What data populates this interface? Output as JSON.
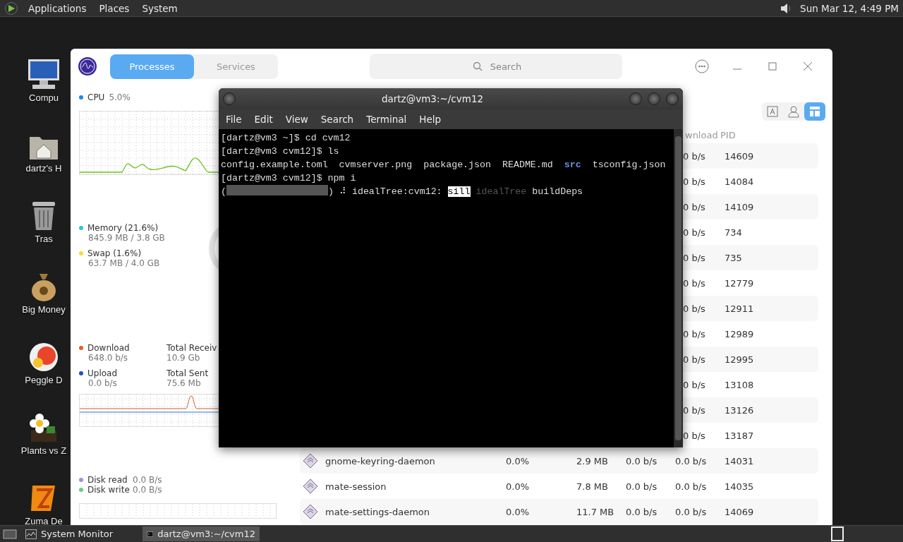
{
  "top_panel": {
    "menus": [
      "Applications",
      "Places",
      "System"
    ],
    "clock": "Sun Mar 12, 4:49 PM"
  },
  "desktop_icons": [
    {
      "kind": "computer",
      "label": "Compu"
    },
    {
      "kind": "home",
      "label": "dartz's H"
    },
    {
      "kind": "trash",
      "label": "Tras"
    },
    {
      "kind": "money",
      "label": "Big Money"
    },
    {
      "kind": "ball",
      "label": "Peggle D"
    },
    {
      "kind": "flower",
      "label": "Plants vs Z"
    },
    {
      "kind": "tile",
      "label": "Zuma De"
    }
  ],
  "system_monitor": {
    "tabs": [
      {
        "label": "Processes",
        "selected": true
      },
      {
        "label": "Services",
        "selected": false
      }
    ],
    "search": {
      "placeholder": "Search"
    },
    "cpu": {
      "label": "CPU",
      "value": "5.0%",
      "color": "#1e88e5"
    },
    "memory": [
      {
        "label": "Memory (21.6%)",
        "detail": "845.9 MB / 3.8 GB",
        "color": "#26c6da"
      },
      {
        "label": "Swap (1.6%)",
        "detail": "63.7 MB / 4.0 GB",
        "color": "#fdd835"
      }
    ],
    "network": [
      {
        "label": "Download",
        "value": "648.0 b/s",
        "color": "#e0602a",
        "total_label": "Total Receiv",
        "total_value": "10.9 Gb"
      },
      {
        "label": "Upload",
        "value": "0.0 b/s",
        "color": "#1f4fcc",
        "total_label": "Total Sent",
        "total_value": "75.6 Mb"
      }
    ],
    "disk": [
      {
        "label": "Disk read",
        "value": "0.0 B/s",
        "color": "#a08de8"
      },
      {
        "label": "Disk write",
        "value": "0.0 B/s",
        "color": "#66cc88"
      }
    ],
    "view_buttons": [
      {
        "kind": "text",
        "selected": false
      },
      {
        "kind": "user",
        "selected": false
      },
      {
        "kind": "tree",
        "selected": true
      }
    ],
    "table": {
      "columns": [
        "wnload",
        "PID"
      ],
      "rows": [
        {
          "download": "0 b/s",
          "pid": "14609"
        },
        {
          "download": "0 b/s",
          "pid": "14084"
        },
        {
          "download": "0 b/s",
          "pid": "14109"
        },
        {
          "download": "0 b/s",
          "pid": "734"
        },
        {
          "download": "0 b/s",
          "pid": "735"
        },
        {
          "download": "0 b/s",
          "pid": "12779"
        },
        {
          "download": "0 b/s",
          "pid": "12911"
        },
        {
          "download": "0 b/s",
          "pid": "12989"
        },
        {
          "download": "0 b/s",
          "pid": "12995"
        },
        {
          "download": "0 b/s",
          "pid": "13108"
        },
        {
          "download": "0 b/s",
          "pid": "13126"
        },
        {
          "download": "0 b/s",
          "pid": "13187"
        },
        {
          "name": "gnome-keyring-daemon",
          "cpu": "0.0%",
          "memory": "2.9 MB",
          "upload": "0.0 b/s",
          "download": "0.0 b/s",
          "pid": "14031"
        },
        {
          "name": "mate-session",
          "cpu": "0.0%",
          "memory": "7.8 MB",
          "upload": "0.0 b/s",
          "download": "0.0 b/s",
          "pid": "14035"
        },
        {
          "name": "mate-settings-daemon",
          "cpu": "0.0%",
          "memory": "11.7 MB",
          "upload": "0.0 b/s",
          "download": "0.0 b/s",
          "pid": "14069"
        }
      ]
    }
  },
  "terminal": {
    "title": "dartz@vm3:~/cvm12",
    "menu": [
      "File",
      "Edit",
      "View",
      "Search",
      "Terminal",
      "Help"
    ],
    "lines": [
      [
        {
          "kind": "text",
          "text": "[dartz@vm3 ~]$ cd cvm12"
        }
      ],
      [
        {
          "kind": "text",
          "text": "[dartz@vm3 cvm12]$ ls"
        }
      ],
      [
        {
          "kind": "text",
          "text": "config.example.toml  cvmserver.png  package.json  README.md  "
        },
        {
          "kind": "dir",
          "text": "src"
        },
        {
          "kind": "text",
          "text": "  tsconfig.json"
        }
      ],
      [
        {
          "kind": "text",
          "text": "[dartz@vm3 cvm12]$ npm i"
        }
      ],
      [
        {
          "kind": "text",
          "text": "("
        },
        {
          "kind": "progress",
          "level": 0
        },
        {
          "kind": "text",
          "text": ") ⠼ idealTree:cvm12: "
        },
        {
          "kind": "inverse",
          "text": "sill"
        },
        {
          "kind": "dim",
          "text": " idealTree"
        },
        {
          "kind": "text",
          "text": " buildDeps"
        }
      ]
    ]
  },
  "taskbar": {
    "tasks": [
      {
        "kind": "monitor",
        "label": "System Monitor",
        "selected": false
      },
      {
        "kind": "terminal",
        "label": "dartz@vm3:~/cvm12",
        "selected": true
      }
    ]
  }
}
